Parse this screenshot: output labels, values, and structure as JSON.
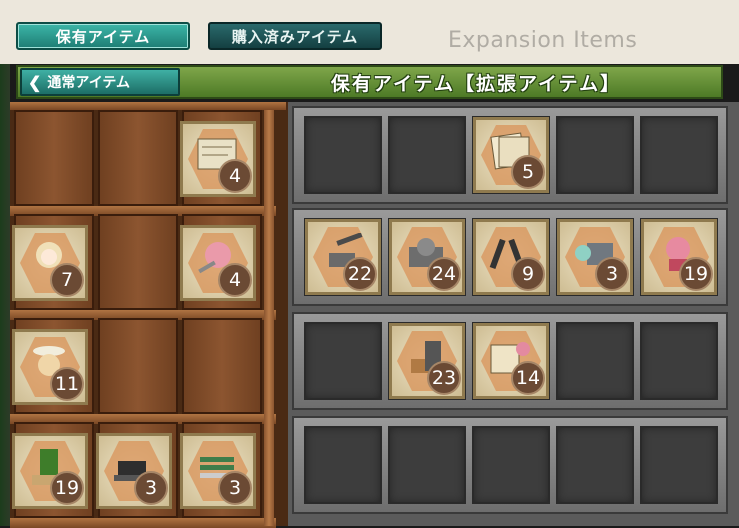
{
  "tabs": {
    "owned": "保有アイテム",
    "purchased": "購入済みアイテム"
  },
  "expansion_label": "Expansion Items",
  "back_button": "通常アイテム",
  "section_title": "保有アイテム【拡張アイテム】",
  "shelf_items": [
    {
      "row": 0,
      "col": 2,
      "icon": "blueprint-icon",
      "count": "4"
    },
    {
      "row": 1,
      "col": 0,
      "icon": "girl-icon",
      "count": "7"
    },
    {
      "row": 1,
      "col": 2,
      "icon": "wrench-girl-icon",
      "count": "4"
    },
    {
      "row": 2,
      "col": 0,
      "icon": "girl-hat-icon",
      "count": "11"
    },
    {
      "row": 3,
      "col": 0,
      "icon": "fuel-can-icon",
      "count": "19"
    },
    {
      "row": 3,
      "col": 1,
      "icon": "bulldozer-icon",
      "count": "3"
    },
    {
      "row": 3,
      "col": 2,
      "icon": "pens-icon",
      "count": "3"
    }
  ],
  "rack_items": [
    {
      "row": 0,
      "col": 2,
      "icon": "documents-icon",
      "count": "5"
    },
    {
      "row": 1,
      "col": 0,
      "icon": "turret-icon",
      "count": "22"
    },
    {
      "row": 1,
      "col": 1,
      "icon": "engine-icon",
      "count": "24"
    },
    {
      "row": 1,
      "col": 2,
      "icon": "launcher-icon",
      "count": "9"
    },
    {
      "row": 1,
      "col": 3,
      "icon": "fairy-machine-icon",
      "count": "3"
    },
    {
      "row": 1,
      "col": 4,
      "icon": "pink-girl-icon",
      "count": "19"
    },
    {
      "row": 2,
      "col": 1,
      "icon": "steel-plates-icon",
      "count": "23"
    },
    {
      "row": 2,
      "col": 2,
      "icon": "papers-girl-icon",
      "count": "14"
    }
  ]
}
